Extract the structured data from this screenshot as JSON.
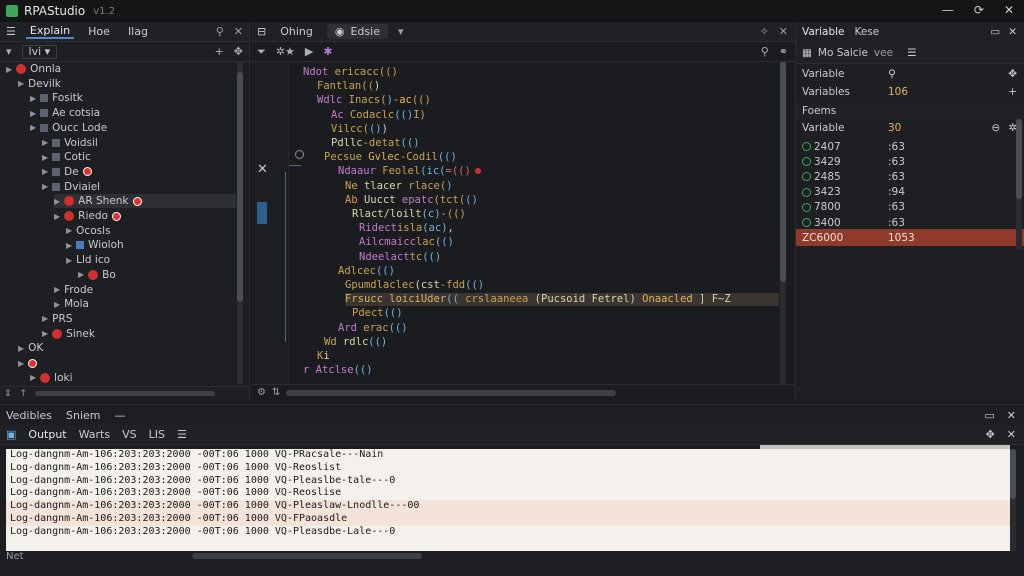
{
  "titlebar": {
    "app_name": "RPAStudio",
    "version": "v1.2"
  },
  "left_panel": {
    "tabs": [
      "Explain",
      "Hoe",
      "Ilag"
    ],
    "dropdown": "lvi",
    "tree": [
      {
        "label": "Onnla",
        "indent": 0,
        "icon": "dot"
      },
      {
        "label": "Devilk",
        "indent": 1,
        "icon": "none"
      },
      {
        "label": "Fositk",
        "indent": 2,
        "icon": "square"
      },
      {
        "label": "Ae cotsia",
        "indent": 2,
        "icon": "square"
      },
      {
        "label": "Oucc Lode",
        "indent": 2,
        "icon": "square"
      },
      {
        "label": "Voidsil",
        "indent": 3,
        "icon": "square"
      },
      {
        "label": "Cotic",
        "indent": 3,
        "icon": "square"
      },
      {
        "label": "De",
        "indent": 3,
        "icon": "square",
        "badge": true
      },
      {
        "label": "Dviaiel",
        "indent": 3,
        "icon": "square"
      },
      {
        "label": "AR Shenk",
        "indent": 4,
        "icon": "dot",
        "badge": true,
        "selected": true
      },
      {
        "label": "Riedo",
        "indent": 4,
        "icon": "dot",
        "badge": true
      },
      {
        "label": "Ocosls",
        "indent": 5,
        "icon": "none"
      },
      {
        "label": "Wioloh",
        "indent": 5,
        "icon": "blue"
      },
      {
        "label": "Lld ico",
        "indent": 5,
        "icon": "none"
      },
      {
        "label": "Bo",
        "indent": 6,
        "icon": "dot",
        "badge": false
      },
      {
        "label": "Frode",
        "indent": 4,
        "icon": "none"
      },
      {
        "label": "Mola",
        "indent": 4,
        "icon": "none"
      },
      {
        "label": "PRS",
        "indent": 3,
        "icon": "none"
      },
      {
        "label": "Sinek",
        "indent": 3,
        "icon": "dot"
      },
      {
        "label": "OK",
        "indent": 1,
        "icon": "none"
      },
      {
        "label": "",
        "indent": 1,
        "icon": "badge"
      },
      {
        "label": "loki",
        "indent": 2,
        "icon": "dot"
      }
    ]
  },
  "editor": {
    "tabs": [
      "Ohing",
      "Edsie"
    ],
    "lines": [
      {
        "indent": 2,
        "parts": [
          [
            "k2",
            "Ndot"
          ],
          [
            "k1",
            " ericacc(()"
          ]
        ]
      },
      {
        "indent": 4,
        "parts": [
          [
            "k1",
            "Fantlan(("
          ],
          [
            "k3",
            ")"
          ]
        ]
      },
      {
        "indent": 4,
        "parts": [
          [
            "k2",
            "Wdlc"
          ],
          [
            "k1",
            " Inacs("
          ],
          [
            "k4",
            ")"
          ],
          [
            "k6",
            "-ac"
          ],
          [
            "k1",
            "(()"
          ]
        ]
      },
      {
        "indent": 6,
        "parts": [
          [
            "k2",
            "Ac"
          ],
          [
            "k1",
            " Codaclc"
          ],
          [
            "k4",
            "(()"
          ],
          [
            "k1",
            "I)"
          ]
        ]
      },
      {
        "indent": 6,
        "parts": [
          [
            "k1",
            "Vilcc("
          ],
          [
            "k4",
            "()"
          ],
          [
            "k3",
            ")"
          ]
        ]
      },
      {
        "indent": 6,
        "parts": [
          [
            "k3",
            "Pdllc"
          ],
          [
            "k1",
            "-detat"
          ],
          [
            "k4",
            "(()"
          ]
        ]
      },
      {
        "indent": 5,
        "parts": [
          [
            "k1",
            "Pecsue"
          ],
          [
            "k6",
            " Gvlec"
          ],
          [
            "k1",
            "-Codil"
          ],
          [
            "k4",
            "(()"
          ]
        ]
      },
      {
        "indent": 7,
        "parts": [
          [
            "k2",
            "Ndaaur"
          ],
          [
            "k1",
            " Feolel"
          ],
          [
            "k4",
            "(ic("
          ],
          [
            "k5",
            "=(()"
          ]
        ],
        "dot": true
      },
      {
        "indent": 8,
        "parts": [
          [
            "k1",
            "Ne"
          ],
          [
            "k3",
            " tlacer"
          ],
          [
            "k1",
            " rlace("
          ],
          [
            "k4",
            ")"
          ]
        ]
      },
      {
        "indent": 8,
        "parts": [
          [
            "k1",
            "Ab"
          ],
          [
            "k3",
            " Uucct"
          ],
          [
            "k2",
            " epatc"
          ],
          [
            "k1",
            "(tct("
          ],
          [
            "k4",
            "()"
          ]
        ]
      },
      {
        "indent": 9,
        "parts": [
          [
            "k3",
            "Rlact/loilt"
          ],
          [
            "k4",
            "(c)"
          ],
          [
            "k1",
            "-(()"
          ]
        ]
      },
      {
        "indent": 10,
        "parts": [
          [
            "k2",
            "Ridect"
          ],
          [
            "k1",
            "isla"
          ],
          [
            "k4",
            "(ac)"
          ],
          [
            "k3",
            ","
          ]
        ]
      },
      {
        "indent": 10,
        "parts": [
          [
            "k2",
            "Ailcmaicc"
          ],
          [
            "k1",
            "lac"
          ],
          [
            "k4",
            "(()"
          ]
        ]
      },
      {
        "indent": 10,
        "parts": [
          [
            "k2",
            "Ndeelact"
          ],
          [
            "k1",
            "tc"
          ],
          [
            "k4",
            "(()"
          ]
        ]
      },
      {
        "indent": 7,
        "parts": [
          [
            "k1",
            "Adlcec"
          ],
          [
            "k4",
            "(()"
          ]
        ]
      },
      {
        "indent": 8,
        "parts": [
          [
            "k1",
            "Gpumdlaclec"
          ],
          [
            "k3",
            "(cst"
          ],
          [
            "k1",
            "-fdd"
          ],
          [
            "k4",
            "(()"
          ]
        ]
      },
      {
        "indent": 8,
        "parts": [
          [
            "k6",
            "Frsucc loiciUder"
          ],
          [
            "k4",
            "(("
          ],
          [
            "k1",
            " crslaaneea"
          ],
          [
            "k3",
            " (Pucsoid Fetrel)"
          ],
          [
            "k6",
            " Onaacled"
          ],
          [
            "k3",
            "  ] F~Z"
          ]
        ],
        "hl": true
      },
      {
        "indent": 9,
        "parts": [
          [
            "k1",
            "Pdect"
          ],
          [
            "k4",
            "(()"
          ]
        ]
      },
      {
        "indent": 7,
        "parts": [
          [
            "k2",
            "Ard"
          ],
          [
            "k1",
            " erac"
          ],
          [
            "k4",
            "(()"
          ]
        ]
      },
      {
        "indent": 5,
        "parts": [
          [
            "k1",
            "Wd"
          ],
          [
            "k3",
            " rdlc"
          ],
          [
            "k4",
            "(()"
          ]
        ]
      },
      {
        "indent": 4,
        "parts": [
          [
            "k1",
            "K"
          ],
          [
            "k3",
            "i"
          ]
        ]
      },
      {
        "indent": 2,
        "parts": [
          [
            "k2",
            "r Atclse"
          ],
          [
            "k4",
            "(()"
          ]
        ]
      }
    ]
  },
  "right_panel": {
    "tabs": [
      "Variable",
      "Kese"
    ],
    "subheader": "Mo Saicie",
    "subheader_suffix": "vee",
    "section1": [
      {
        "label": "Variable",
        "value": ""
      },
      {
        "label": "Variables",
        "value": "106"
      }
    ],
    "section2_title": "Foems",
    "section2_header": {
      "label": "Variable",
      "value": "30"
    },
    "section2_rows": [
      {
        "label": "2407",
        "value": ":63"
      },
      {
        "label": "3429",
        "value": ":63"
      },
      {
        "label": "2485",
        "value": ":63"
      },
      {
        "label": "3423",
        "value": ":94"
      },
      {
        "label": "7800",
        "value": ":63"
      },
      {
        "label": "3400",
        "value": ":63"
      }
    ],
    "selected_row": {
      "label": "ZC6000",
      "value": "1053"
    }
  },
  "bottom_panel": {
    "tabs": [
      "Vedibles",
      "Sniem"
    ],
    "subtabs": [
      "Output",
      "Warts",
      "VS",
      "LIS"
    ],
    "log": [
      "Log-dangnm-Am-106:203:203:2000 -00T:06 1000 VQ-PRacsale---Nain",
      "Log-dangnm-Am-106:203:203:2000 -00T:06 1000 VQ-Reoslist",
      "Log-dangnm-Am-106:203:203:2000 -00T:06 1000 VQ-Pleaslbe-tale---0",
      "Log-dangnm-Am-106:203:203:2000 -00T:06 1000 VQ-Reoslise",
      "Log-dangnm-Am-106:203:203:2000 -00T:06 1000 VQ-Pleaslaw-Lnodlle---00",
      "Log-dangnm-Am-106:203:203:2000 -00T:06 1000 VQ-FPaoasdle",
      "Log-dangnm-Am-106:203:203:2000 -00T:06 1000 VQ-Pleasdbe-Lale---0"
    ],
    "footer": "Net"
  }
}
